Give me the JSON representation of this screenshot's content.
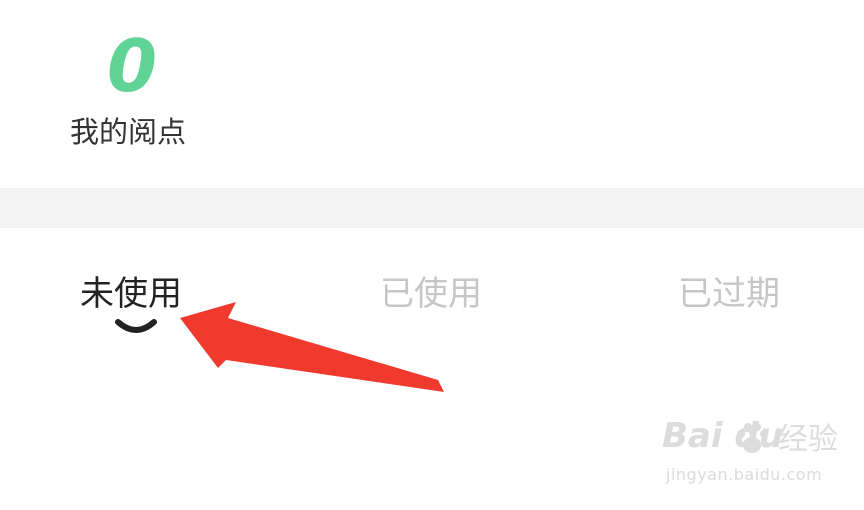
{
  "points": {
    "value": "0",
    "label": "我的阅点"
  },
  "tabs": [
    {
      "label": "未使用",
      "active": true
    },
    {
      "label": "已使用",
      "active": false
    },
    {
      "label": "已过期",
      "active": false
    }
  ],
  "annotation": {
    "arrow_color": "#f03a2e"
  },
  "watermark": {
    "logo": "Bai  du",
    "experience": "经验",
    "url": "jingyan.baidu.com"
  },
  "colors": {
    "points_accent": "#5fd494",
    "active_tab_text": "#222222",
    "inactive_tab_text": "#c6c6c6",
    "divider_band": "#f3f3f3"
  }
}
